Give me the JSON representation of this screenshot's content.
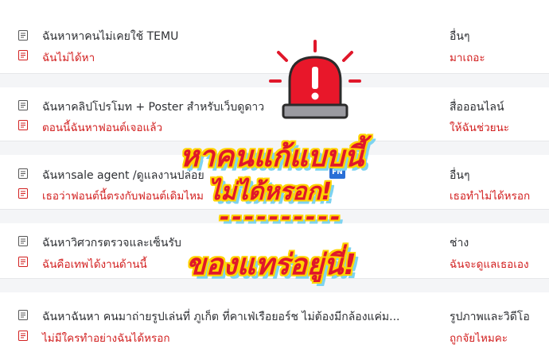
{
  "rows": [
    {
      "title": "ฉันหาหาคนไม่เคยใช้ TEMU",
      "subtitle": "ฉันไม่ได้หา",
      "category": "อื่นๆ",
      "category_note": "มาเถอะ"
    },
    {
      "title": "ฉันหาคลิปโปรโมท + Poster สำหรับเว็บดูดาว",
      "subtitle": "ตอนนี้ฉันหาฟอนต์เจอแล้ว",
      "category": "สื่อออนไลน์",
      "category_note": "ให้ฉันช่วยนะ"
    },
    {
      "title": "ฉันหาsale agent /ดูแลงานปล่อย",
      "subtitle": "เธอว่าฟอนต์นี้ตรงกับฟอนต์เดิมไหม",
      "category": "อื่นๆ",
      "category_note": "เธอทำไม่ได้หรอก",
      "badge": "FN"
    },
    {
      "title": "ฉันหาวิศวกรตรวจและเซ็นรับ",
      "subtitle": "ฉันคือเทพได้งานด้านนี้",
      "category": "ช่าง",
      "category_note": "ฉันจะดูแลเธอเอง"
    },
    {
      "title": "ฉันหาฉันหา คนมาถ่ายรูปเล่นที่ ภูเก็ต ที่คาเฟ่เรือยอร์ช ไม่ต้องมีกล้องแค่ม...",
      "subtitle": "ไม่มีใครทำอย่างฉันได้หรอก",
      "category": "รูปภาพและวิดีโอ",
      "category_note": "ถูกจัยไหมคะ"
    }
  ],
  "overlay": {
    "line1": "หาคนแก้แบบนี้",
    "line2": "ไม่ได้หรอก!",
    "line3": "----------",
    "line4": "ของแทร่อยู่นี่!"
  },
  "icons": {
    "row_icon": "document-icon",
    "alert": "siren-icon"
  },
  "colors": {
    "accent_red": "#d21f1f",
    "overlay_red": "#e0172a",
    "overlay_outline": "#ffd400",
    "overlay_shadow": "#7dd3f0"
  }
}
